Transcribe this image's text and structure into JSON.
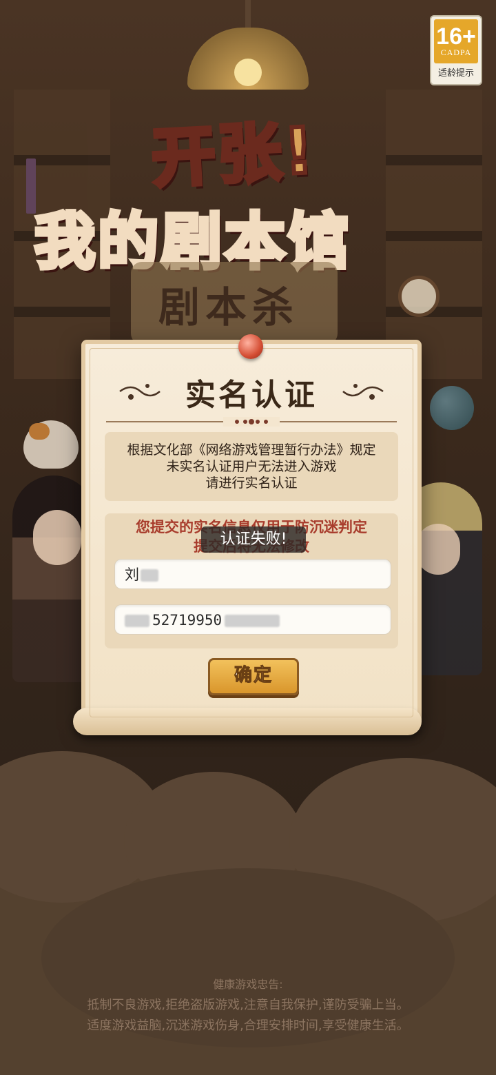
{
  "age_rating": {
    "number": "16+",
    "org": "CADPA",
    "label": "适龄提示"
  },
  "game_title": {
    "line1": "开张!",
    "line2": "我的剧本馆",
    "sign": "剧本杀"
  },
  "dialog": {
    "title": "实名认证",
    "notice": [
      "根据文化部《网络游戏管理暂行办法》规定",
      "未实名认证用户无法进入游戏",
      "请进行实名认证"
    ],
    "privacy": [
      "您提交的实名信息仅用于防沉迷判定",
      "提交后将无法修改"
    ],
    "name_field": {
      "visible_value": "刘"
    },
    "id_field": {
      "visible_value": "52719950"
    },
    "confirm_label": "确定"
  },
  "toast": {
    "message": "认证失败!"
  },
  "health_advice": {
    "title": "健康游戏忠告:",
    "lines": [
      "抵制不良游戏,拒绝盗版游戏,注意自我保护,谨防受骗上当。",
      "适度游戏益脑,沉迷游戏伤身,合理安排时间,享受健康生活。"
    ]
  },
  "colors": {
    "dialog_bg": "#f7ecda",
    "privacy_text": "#a83c2c",
    "button": "#e5a72a",
    "scene_bg": "#3a2a1e"
  }
}
